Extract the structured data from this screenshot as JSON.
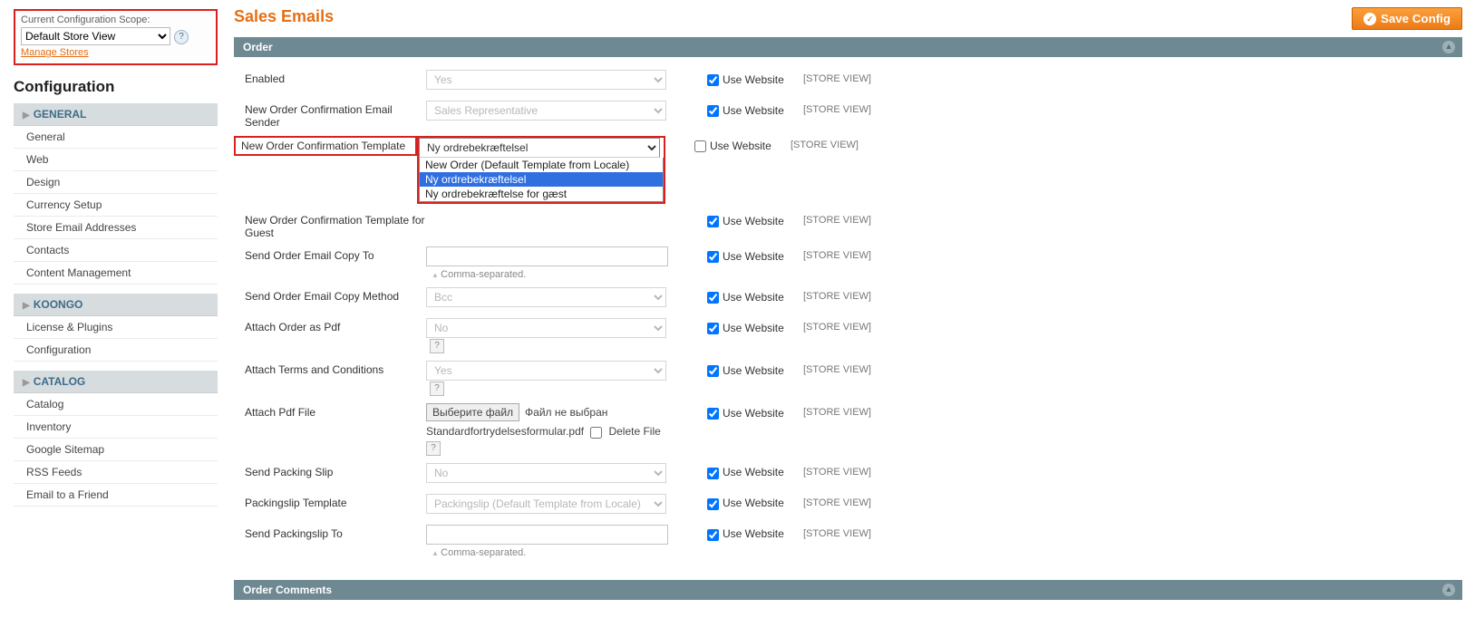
{
  "sidebar": {
    "scope_label": "Current Configuration Scope:",
    "scope_value": "Default Store View",
    "manage_stores": "Manage Stores",
    "config_title": "Configuration",
    "groups": [
      {
        "header": "GENERAL",
        "items": [
          "General",
          "Web",
          "Design",
          "Currency Setup",
          "Store Email Addresses",
          "Contacts",
          "Content Management"
        ]
      },
      {
        "header": "KOONGO",
        "items": [
          "License & Plugins",
          "Configuration"
        ]
      },
      {
        "header": "CATALOG",
        "items": [
          "Catalog",
          "Inventory",
          "Google Sitemap",
          "RSS Feeds",
          "Email to a Friend"
        ]
      }
    ]
  },
  "header": {
    "title": "Sales Emails",
    "save_label": "Save Config"
  },
  "section": {
    "title": "Order",
    "use_website": "Use Website",
    "scope": "[STORE VIEW]",
    "rows": {
      "enabled": {
        "label": "Enabled",
        "value": "Yes",
        "chk": true
      },
      "sender": {
        "label": "New Order Confirmation Email Sender",
        "value": "Sales Representative",
        "chk": true
      },
      "template": {
        "label": "New Order Confirmation Template",
        "value": "Ny ordrebekræftelsel",
        "chk": false,
        "options": [
          "New Order (Default Template from Locale)",
          "Ny ordrebekræftelsel",
          "Ny ordrebekræftelse for gæst"
        ]
      },
      "template_guest": {
        "label": "New Order Confirmation Template for Guest",
        "chk": true
      },
      "copy_to": {
        "label": "Send Order Email Copy To",
        "note": "Comma-separated.",
        "chk": true
      },
      "copy_method": {
        "label": "Send Order Email Copy Method",
        "value": "Bcc",
        "chk": true
      },
      "attach_pdf": {
        "label": "Attach Order as Pdf",
        "value": "No",
        "chk": true
      },
      "attach_tc": {
        "label": "Attach Terms and Conditions",
        "value": "Yes",
        "chk": true
      },
      "attach_file": {
        "label": "Attach Pdf File",
        "button": "Выберите файл",
        "file_text": "Файл не выбран",
        "current": "Standardfortrydelsesformular.pdf",
        "delete": "Delete File",
        "chk": true
      },
      "packing_slip": {
        "label": "Send Packing Slip",
        "value": "No",
        "chk": true
      },
      "packing_tmpl": {
        "label": "Packingslip Template",
        "value": "Packingslip (Default Template from Locale)",
        "chk": true
      },
      "packing_to": {
        "label": "Send Packingslip To",
        "note": "Comma-separated.",
        "chk": true
      }
    }
  },
  "section2": {
    "title": "Order Comments"
  }
}
